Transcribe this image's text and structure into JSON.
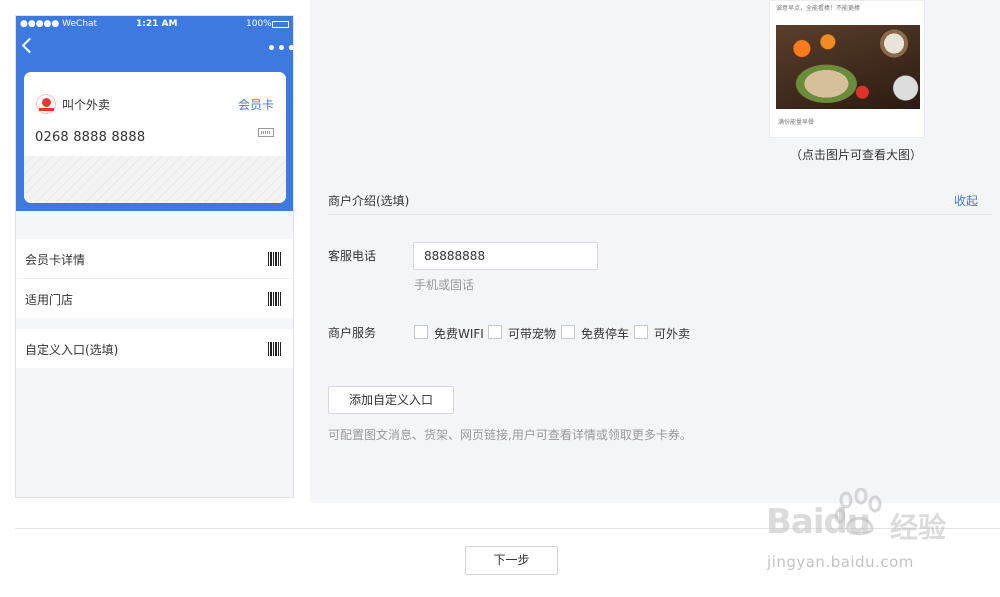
{
  "phone": {
    "status": {
      "carrier": "●●●●● WeChat",
      "time": "1:21 AM",
      "battery": "100%"
    },
    "card": {
      "merchant": "叫个外卖",
      "type_label": "会员卡",
      "number": "0268 8888 8888"
    },
    "rows": [
      {
        "label": "会员卡详情"
      },
      {
        "label": "适用门店"
      },
      {
        "label": "自定义入口(选填)"
      }
    ]
  },
  "preview": {
    "caption_top": "诚意早点，全能看棒！不能更棒",
    "caption_bottom": "满份能量早餐",
    "hint": "（点击图片可查看大图）"
  },
  "form": {
    "intro_title": "商户介绍(选填)",
    "collapse": "收起",
    "phone_label": "客服电话",
    "phone_value": "88888888",
    "phone_hint": "手机或固话",
    "service_label": "商户服务",
    "services": [
      {
        "label": "免费WIFI",
        "checked": false
      },
      {
        "label": "可带宠物",
        "checked": false
      },
      {
        "label": "免费停车",
        "checked": false
      },
      {
        "label": "可外卖",
        "checked": false
      }
    ],
    "add_entry": "添加自定义入口",
    "entry_hint": "可配置图文消息、货架、网页链接,用户可查看详情或领取更多卡券。"
  },
  "footer": {
    "next": "下一步"
  },
  "watermark": {
    "brand": "Baidu",
    "suffix": "经验",
    "url": "jingyan.baidu.com"
  },
  "colors": {
    "accent": "#3d7ae0",
    "panel_bg": "#f4f5f9",
    "logo_red": "#e53935"
  }
}
